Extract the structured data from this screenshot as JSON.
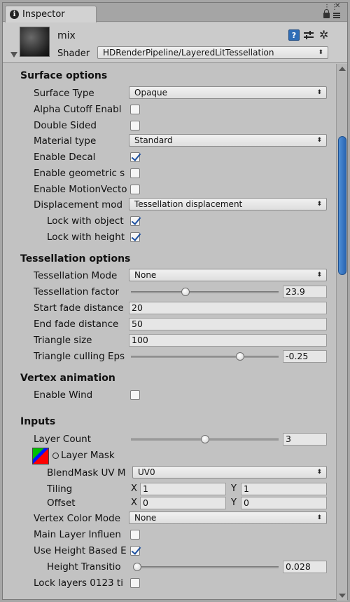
{
  "window": {
    "tab_label": "Inspector"
  },
  "header": {
    "material_name": "mix",
    "shader_label": "Shader",
    "shader_value": "HDRenderPipeline/LayeredLitTessellation"
  },
  "surface": {
    "title": "Surface options",
    "surface_type_label": "Surface Type",
    "surface_type_value": "Opaque",
    "alpha_cutoff_label": "Alpha Cutoff Enabl",
    "double_sided_label": "Double Sided",
    "material_type_label": "Material type",
    "material_type_value": "Standard",
    "enable_decal_label": "Enable Decal",
    "enable_geometric_label": "Enable geometric s",
    "enable_motion_label": "Enable MotionVecto",
    "displacement_label": "Displacement mod",
    "displacement_value": "Tessellation displacement",
    "lock_object_label": "Lock with object",
    "lock_height_label": "Lock with height"
  },
  "checks": {
    "alpha_cutoff": false,
    "double_sided": false,
    "enable_decal": true,
    "enable_geometric": false,
    "enable_motion": false,
    "lock_object": true,
    "lock_height": true,
    "enable_wind": false,
    "main_layer_influence": false,
    "use_height_based": true,
    "lock_layers": false
  },
  "tessellation": {
    "title": "Tessellation options",
    "mode_label": "Tessellation Mode",
    "mode_value": "None",
    "factor_label": "Tessellation factor",
    "factor_value": "23.9",
    "factor_level": 0.37,
    "start_fade_label": "Start fade distance",
    "start_fade_value": "20",
    "end_fade_label": "End fade distance",
    "end_fade_value": "50",
    "triangle_size_label": "Triangle size",
    "triangle_size_value": "100",
    "culling_label": "Triangle culling Eps",
    "culling_value": "-0.25",
    "culling_level": 0.74
  },
  "vertex_anim": {
    "title": "Vertex animation",
    "enable_wind_label": "Enable Wind"
  },
  "inputs": {
    "title": "Inputs",
    "layer_count_label": "Layer Count",
    "layer_count_value": "3",
    "layer_count_level": 0.5,
    "layer_mask_label": "Layer Mask",
    "blendmask_uv_label": "BlendMask UV M",
    "blendmask_uv_value": "UV0",
    "tiling_label": "Tiling",
    "tiling_x": "1",
    "tiling_y": "1",
    "offset_label": "Offset",
    "offset_x": "0",
    "offset_y": "0",
    "x_label": "X",
    "y_label": "Y",
    "vertex_color_label": "Vertex Color Mode",
    "vertex_color_value": "None",
    "main_layer_label": "Main Layer Influen",
    "use_height_label": "Use Height Based E",
    "height_transition_label": "Height Transitio",
    "height_transition_value": "0.028",
    "height_transition_level": 0.03,
    "lock_layers_label": "Lock layers 0123 ti"
  },
  "colors": {
    "accent": "#2a66b3",
    "panel": "#c2c2c2"
  }
}
